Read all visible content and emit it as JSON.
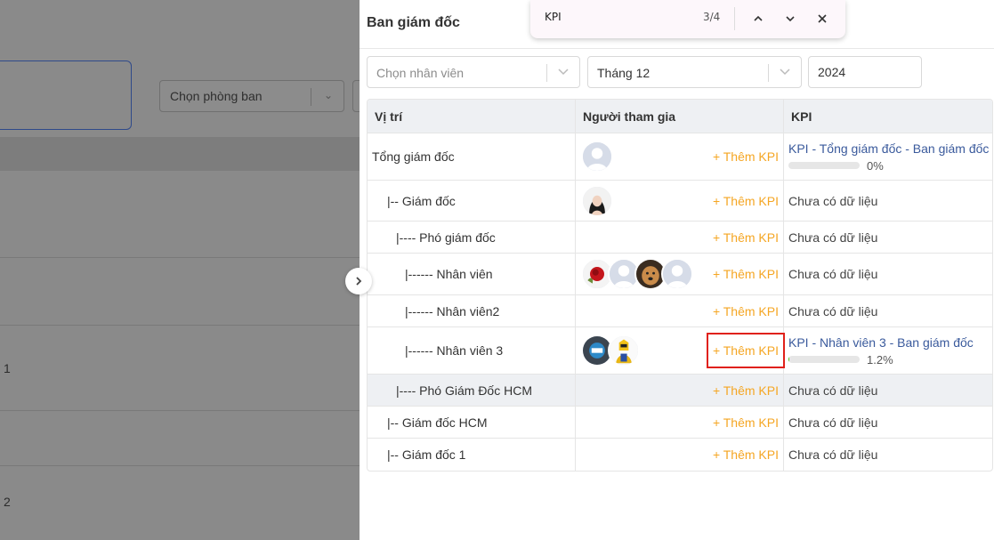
{
  "background": {
    "dept_select_placeholder": "Chọn phòng ban",
    "row_numbers": [
      "1",
      "2"
    ]
  },
  "drawer": {
    "title": "Ban giám đốc"
  },
  "filters": {
    "employee_placeholder": "Chọn nhân viên",
    "month_value": "Tháng 12",
    "year_value": "2024"
  },
  "findbar": {
    "query": "KPI",
    "count": "3/4",
    "icons": [
      "chevron-up-icon",
      "chevron-down-icon",
      "close-icon"
    ]
  },
  "table": {
    "headers": {
      "position": "Vị trí",
      "participants": "Người tham gia",
      "kpi": "KPI"
    },
    "add_kpi_label": "+ Thêm KPI",
    "rows": [
      {
        "position": "Tổng giám đốc",
        "avatars": [
          "default"
        ],
        "kpi_title": "KPI - Tổng giám đốc - Ban giám đốc",
        "progress_text": "0%",
        "progress": 0
      },
      {
        "position": "|-- Giám đốc",
        "avatars": [
          "person"
        ],
        "kpi_empty": "Chưa có dữ liệu"
      },
      {
        "position": "|---- Phó giám đốc",
        "avatars": [],
        "kpi_empty": "Chưa có dữ liệu"
      },
      {
        "position": "|------ Nhân viên",
        "avatars": [
          "rose",
          "default",
          "dog",
          "default"
        ],
        "kpi_empty": "Chưa có dữ liệu"
      },
      {
        "position": "|------ Nhân viên2",
        "avatars": [],
        "kpi_empty": "Chưa có dữ liệu"
      },
      {
        "position": "|------ Nhân viên 3",
        "avatars": [
          "logo",
          "hero"
        ],
        "kpi_title": "KPI - Nhân viên 3 - Ban giám đốc",
        "progress_text": "1.2%",
        "progress": 1.2
      },
      {
        "position": "|---- Phó Giám Đốc HCM",
        "avatars": [],
        "kpi_empty": "Chưa có dữ liệu"
      },
      {
        "position": "|-- Giám đốc HCM",
        "avatars": [],
        "kpi_empty": "Chưa có dữ liệu"
      },
      {
        "position": "|-- Giám đốc 1",
        "avatars": [],
        "kpi_empty": "Chưa có dữ liệu"
      }
    ]
  },
  "colors": {
    "accent_orange": "#f5a623",
    "link_blue": "#3a5a9c",
    "highlight_red": "#e0211a",
    "progress_green": "#52c41a"
  }
}
